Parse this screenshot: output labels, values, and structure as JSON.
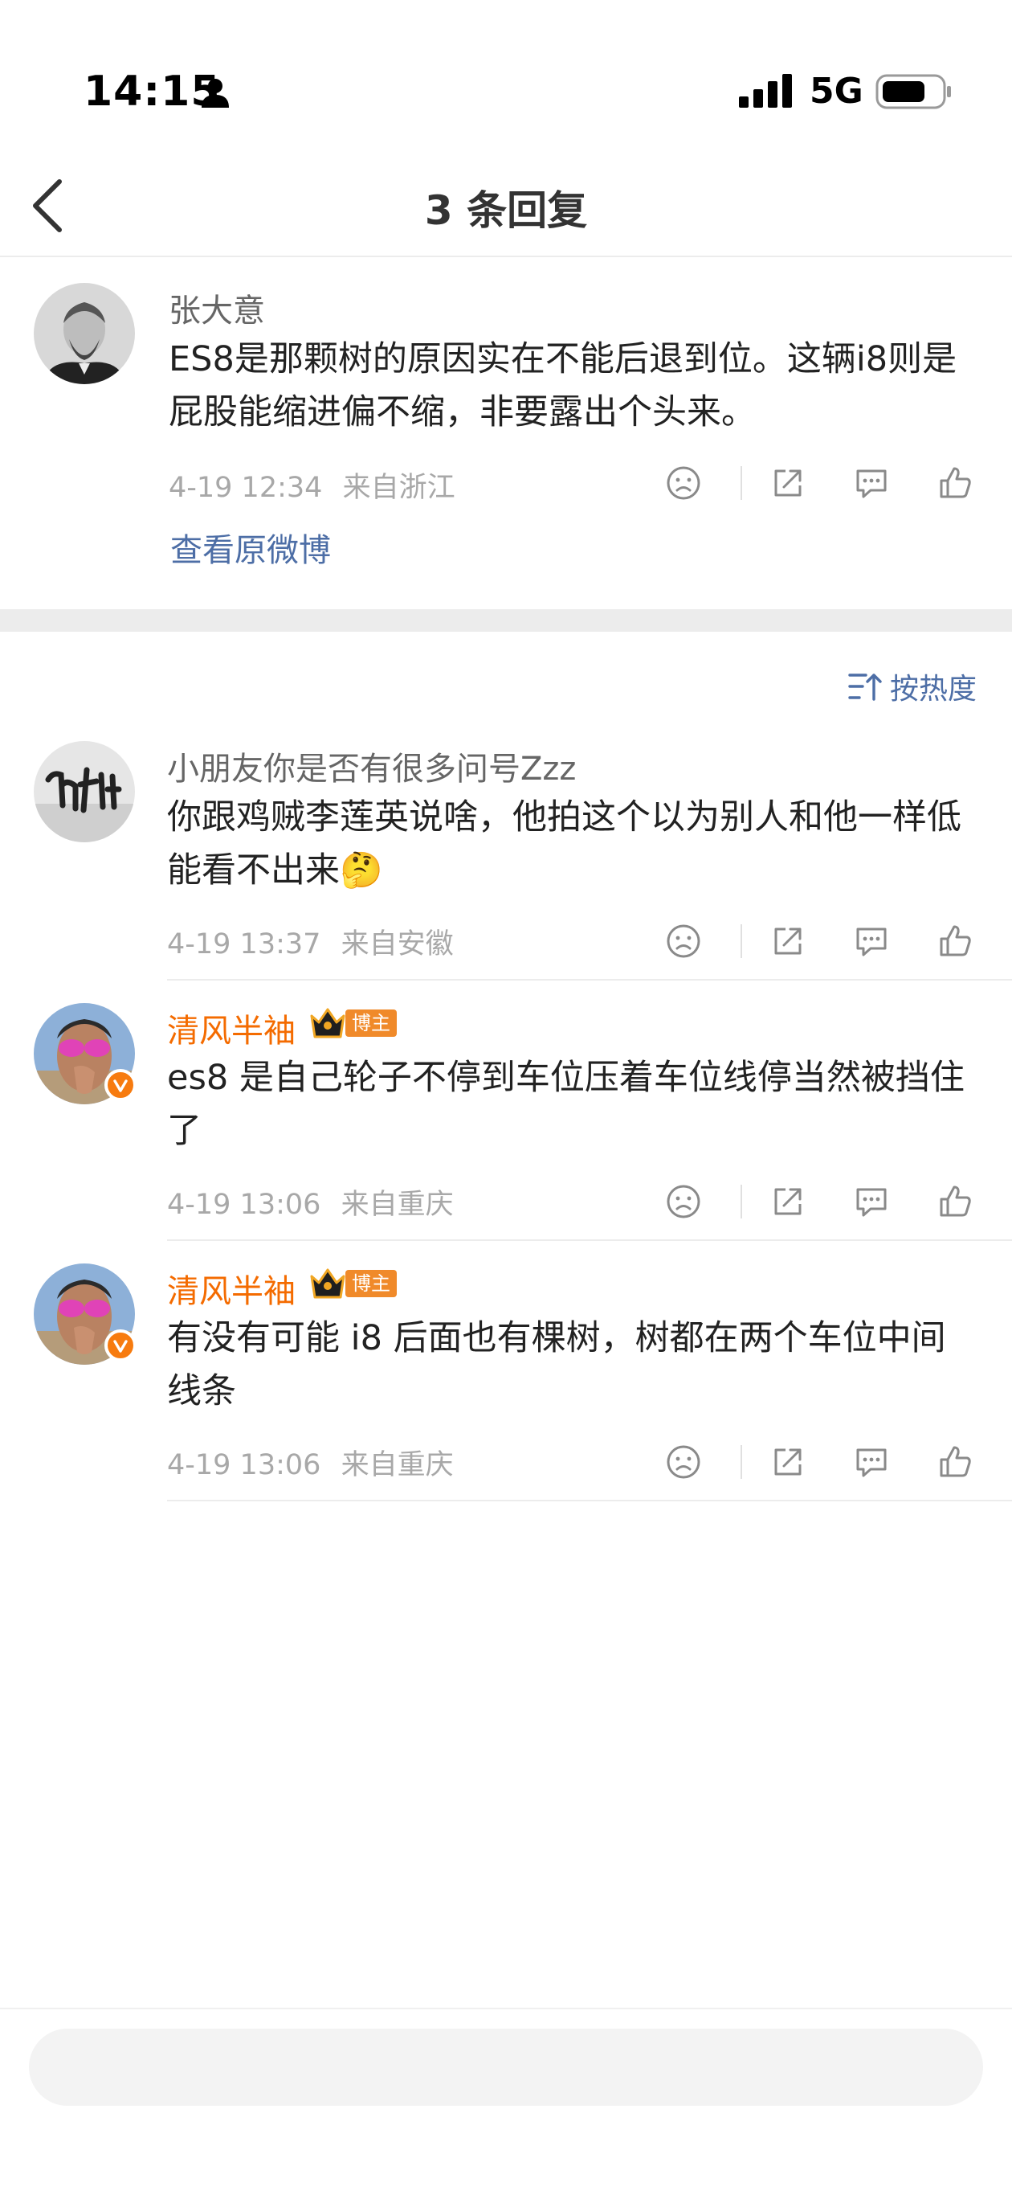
{
  "status_bar": {
    "time": "14:15",
    "network": "5G"
  },
  "nav": {
    "title": "3 条回复"
  },
  "root_comment": {
    "username": "张大意",
    "text": "ES8是那颗树的原因实在不能后退到位。这辆i8则是屁股能缩进偏不缩，非要露出个头来。",
    "time": "4-19 12:34",
    "location": "来自浙江",
    "view_original_label": "查看原微博"
  },
  "sort": {
    "label": "按热度"
  },
  "replies": [
    {
      "username": "小朋友你是否有很多问号Zzz",
      "text": "你跟鸡贼李莲英说啥，他拍这个以为别人和他一样低能看不出来",
      "emoji": "🤔",
      "time": "4-19 13:37",
      "location": "来自安徽"
    },
    {
      "username": "清风半袖",
      "badge_label": "博主",
      "text": "es8 是自己轮子不停到车位压着车位线停当然被挡住了",
      "time": "4-19 13:06",
      "location": "来自重庆"
    },
    {
      "username": "清风半袖",
      "badge_label": "博主",
      "text": "有没有可能 i8 后面也有棵树，树都在两个车位中间线条",
      "time": "4-19 13:06",
      "location": "来自重庆"
    }
  ],
  "input": {
    "placeholder": ""
  },
  "colors": {
    "accent_blue": "#4d6ea6",
    "username_orange": "#f46b00",
    "verified_orange": "#f77b0f"
  },
  "icons": [
    "person-icon",
    "signal-icon",
    "battery-icon",
    "back-icon",
    "dislike-icon",
    "share-icon",
    "comment-icon",
    "like-icon",
    "sort-icon",
    "crown-icon",
    "verified-icon"
  ]
}
